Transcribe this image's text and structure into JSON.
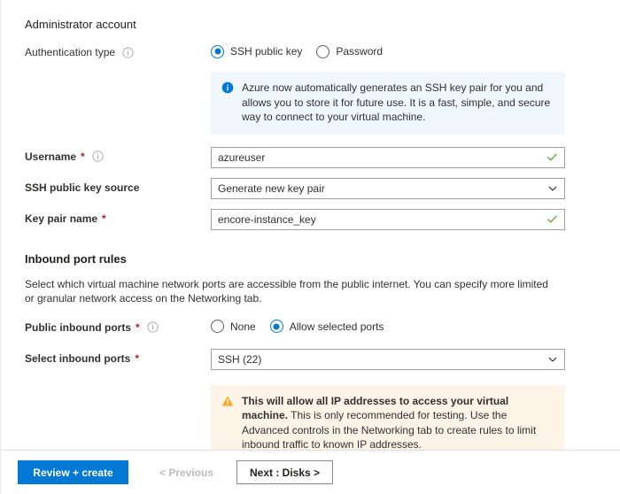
{
  "admin_section": {
    "heading": "Administrator account",
    "auth_type": {
      "label": "Authentication type",
      "info_icon": "info-circle-icon",
      "options": [
        {
          "label": "SSH public key",
          "selected": true
        },
        {
          "label": "Password",
          "selected": false
        }
      ]
    },
    "info_message": {
      "icon": "info-filled-icon",
      "text": "Azure now automatically generates an SSH key pair for you and allows you to store it for future use. It is a fast, simple, and secure way to connect to your virtual machine."
    },
    "username": {
      "label": "Username",
      "required": "*",
      "info_icon": "info-circle-icon",
      "value": "azureuser",
      "validation_icon": "green-check-icon"
    },
    "key_source": {
      "label": "SSH public key source",
      "value": "Generate new key pair",
      "chevron_icon": "chevron-down-icon"
    },
    "key_pair_name": {
      "label": "Key pair name",
      "required": "*",
      "value": "encore-instance_key",
      "validation_icon": "green-check-icon"
    }
  },
  "inbound_section": {
    "heading": "Inbound port rules",
    "description": "Select which virtual machine network ports are accessible from the public internet. You can specify more limited or granular network access on the Networking tab.",
    "public_ports": {
      "label": "Public inbound ports",
      "required": "*",
      "info_icon": "info-circle-icon",
      "options": [
        {
          "label": "None",
          "selected": false
        },
        {
          "label": "Allow selected ports",
          "selected": true
        }
      ]
    },
    "select_ports": {
      "label": "Select inbound ports",
      "required": "*",
      "value": "SSH (22)",
      "chevron_icon": "chevron-down-icon"
    },
    "warning_message": {
      "icon": "warning-triangle-icon",
      "bold_text": "This will allow all IP addresses to access your virtual machine.",
      "rest_text": " This is only recommended for testing.  Use the Advanced controls in the Networking tab to create rules to limit inbound traffic to known IP addresses."
    }
  },
  "footer": {
    "review_create_label": "Review + create",
    "previous_label": "< Previous",
    "next_label": "Next : Disks >"
  },
  "colors": {
    "accent": "#0078d4",
    "info_bg": "#eff6fc",
    "warning_bg": "#fdf3e7",
    "warning_icon": "#f7a828",
    "required_red": "#a4262c",
    "success_green": "#4caf34"
  }
}
